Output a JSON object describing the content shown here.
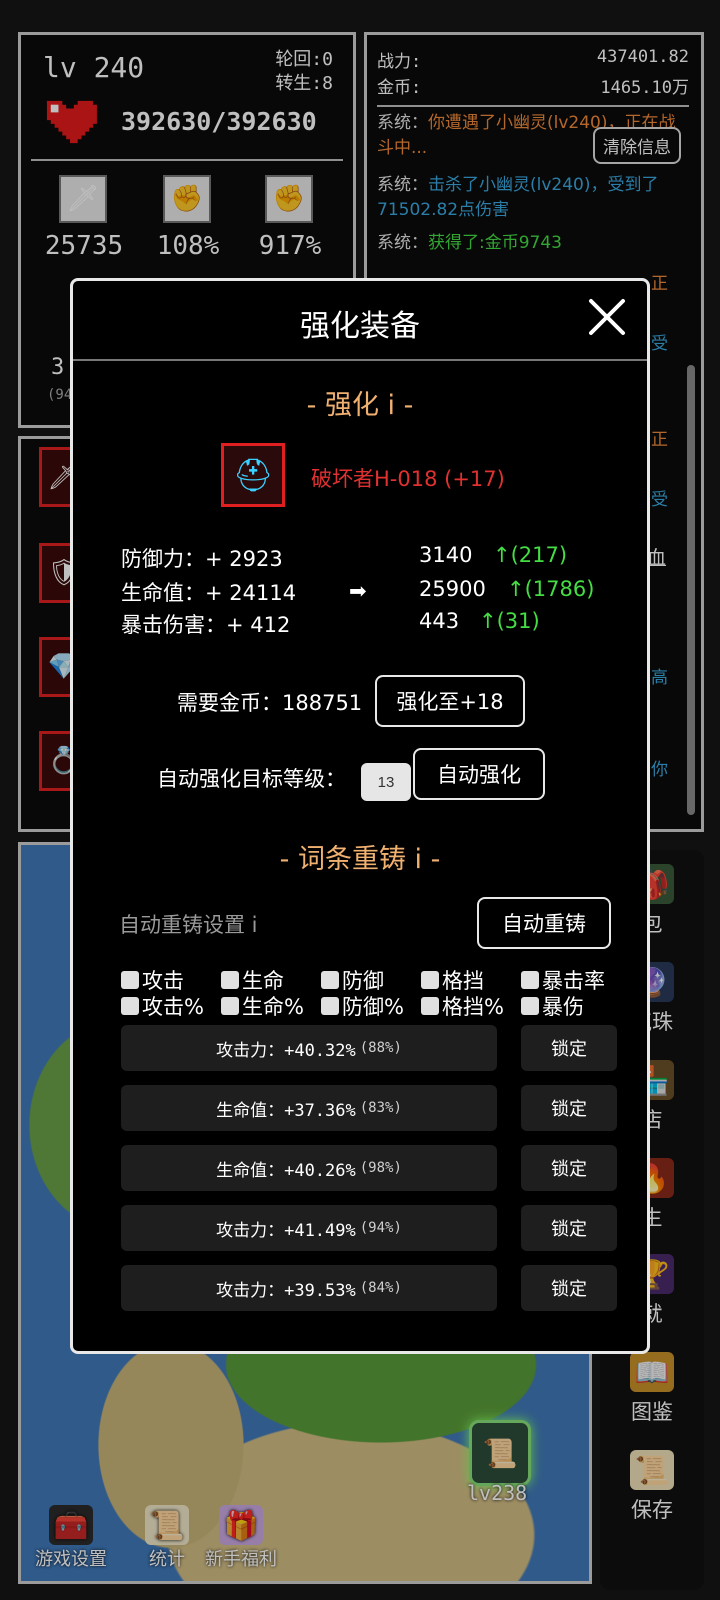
{
  "player": {
    "level_label": "lv 240",
    "samsara_label": "轮回:0",
    "rebirth_label": "转生:8",
    "hp": "392630/392630",
    "stats": [
      {
        "icon": "sword-icon",
        "value": "25735"
      },
      {
        "icon": "crit-fist-icon",
        "value": "108%"
      },
      {
        "icon": "crit-damage-fist-icon",
        "value": "917%"
      }
    ],
    "partial_stat": "3",
    "partial_stat_sub": "(94"
  },
  "log_panel": {
    "power_label": "战力:",
    "power_value": "437401.82",
    "gold_label": "金币:",
    "gold_value": "1465.10万",
    "clear_button": "清除信息",
    "entries": [
      {
        "tag": "系统：",
        "text": "你遭遇了小幽灵(lv240)，正在战斗中...",
        "color": "#f08a3a"
      },
      {
        "tag": "系统：",
        "text": "击杀了小幽灵(lv240)，受到了71502.82点伤害",
        "color": "#3aa8e0"
      },
      {
        "tag": "系统：",
        "text": "获得了:金币9743",
        "color": "#44dd44"
      }
    ],
    "peek_fragments": [
      "正",
      "受",
      "正",
      "受",
      "血",
      "高",
      "你"
    ]
  },
  "menu": {
    "items": [
      {
        "icon": "bag-icon",
        "label": "包"
      },
      {
        "icon": "orb-icon",
        "label": "气珠"
      },
      {
        "icon": "shop-icon",
        "label": "店"
      },
      {
        "icon": "rebirth-icon",
        "label": "生"
      },
      {
        "icon": "achievement-icon",
        "label": "就"
      },
      {
        "icon": "codex-book-icon",
        "label": "图鉴"
      },
      {
        "icon": "scroll-save-icon",
        "label": "保存"
      }
    ]
  },
  "map": {
    "bottom_buttons": [
      {
        "icon": "settings-chest-icon",
        "label": "游戏设置"
      },
      {
        "icon": "stats-scroll-icon",
        "label": "统计"
      },
      {
        "icon": "newbie-gift-icon",
        "label": "新手福利"
      }
    ],
    "player_marker_level": "lv238"
  },
  "modal": {
    "title": "强化装备",
    "enhance_section_title": "- 强化 i -",
    "item_name": "破坏者H-018 (+17)",
    "stats": [
      {
        "label": "防御力：+ 2923",
        "new_value": "3140",
        "delta": "↑(217)"
      },
      {
        "label": "生命值：+ 24114",
        "new_value": "25900",
        "delta": "↑(1786)"
      },
      {
        "label": "暴击伤害：+ 412",
        "new_value": "443",
        "delta": "↑(31)"
      }
    ],
    "arrow": "➡",
    "cost_label": "需要金币：188751",
    "enhance_button": "强化至+18",
    "auto_target_label": "自动强化目标等级：",
    "auto_target_value": "13",
    "auto_enhance_button": "自动强化",
    "reforge_section_title": "- 词条重铸 i -",
    "auto_reforge_settings_label": "自动重铸设置 i",
    "auto_reforge_button": "自动重铸",
    "checkbox_row1": [
      "攻击",
      "生命",
      "防御",
      "格挡",
      "暴击率"
    ],
    "checkbox_row2": [
      "攻击%",
      "生命%",
      "防御%",
      "格挡%",
      "暴伤"
    ],
    "affixes": [
      {
        "text": "攻击力：+40.32%",
        "quality": "(88%)"
      },
      {
        "text": "生命值：+37.36%",
        "quality": "(83%)"
      },
      {
        "text": "生命值：+40.26%",
        "quality": "(98%)"
      },
      {
        "text": "攻击力：+41.49%",
        "quality": "(94%)"
      },
      {
        "text": "攻击力：+39.53%",
        "quality": "(84%)"
      }
    ],
    "lock_label": "锁定"
  }
}
